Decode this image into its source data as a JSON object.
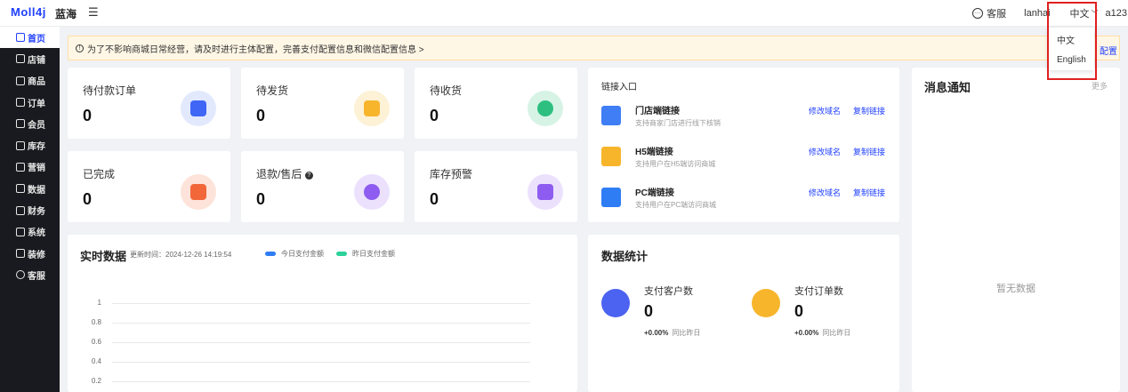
{
  "header": {
    "logo": "Moll4j",
    "shop_name": "蓝海",
    "menu_icon": "menu-icon",
    "service_label": "客服",
    "username": "lanhai",
    "language": "中文",
    "account": "a123"
  },
  "language_menu": {
    "options": [
      "中文",
      "English"
    ]
  },
  "sidebar": {
    "items": [
      {
        "label": "首页",
        "icon": "home-icon"
      },
      {
        "label": "店铺",
        "icon": "shop-icon"
      },
      {
        "label": "商品",
        "icon": "goods-icon"
      },
      {
        "label": "订单",
        "icon": "order-icon"
      },
      {
        "label": "会员",
        "icon": "member-icon"
      },
      {
        "label": "库存",
        "icon": "stock-icon"
      },
      {
        "label": "营销",
        "icon": "gift-icon"
      },
      {
        "label": "数据",
        "icon": "data-icon"
      },
      {
        "label": "财务",
        "icon": "finance-icon"
      },
      {
        "label": "系统",
        "icon": "settings-icon"
      },
      {
        "label": "装修",
        "icon": "decorate-icon"
      },
      {
        "label": "客服",
        "icon": "chat-icon"
      }
    ]
  },
  "alert": {
    "text": "为了不影响商城日常经营，请及时进行主体配置，完善支付配置信息和微信配置信息 >",
    "link": "配置"
  },
  "stats": [
    {
      "label": "待付款订单",
      "value": "0",
      "icon": "wallet-icon",
      "color": "#3f66f5",
      "bg": "#e3e9fd"
    },
    {
      "label": "待发货",
      "value": "0",
      "icon": "truck-icon",
      "color": "#f7b52c",
      "bg": "#fdf1d6"
    },
    {
      "label": "待收货",
      "value": "0",
      "icon": "receiver-icon",
      "color": "#2cbf80",
      "bg": "#d7f3e6"
    },
    {
      "label": "已完成",
      "value": "0",
      "icon": "bag-icon",
      "color": "#f2673a",
      "bg": "#fde3da"
    },
    {
      "label": "退款/售后",
      "value": "0",
      "icon": "money-bag-icon",
      "color": "#8e5cf0",
      "bg": "#ebe1fd"
    },
    {
      "label": "库存预警",
      "value": "0",
      "icon": "box-icon",
      "color": "#8e5cf0",
      "bg": "#ebe1fd"
    }
  ],
  "links": {
    "title": "链接入口",
    "edit_label": "修改域名",
    "copy_label": "复制链接",
    "items": [
      {
        "name": "门店端链接",
        "desc": "支持商家门店进行线下核销",
        "icon": "store-icon",
        "color": "#3f7ef5"
      },
      {
        "name": "H5端链接",
        "desc": "支持用户在H5端访问商城",
        "icon": "h5-icon",
        "color": "#f7b52c"
      },
      {
        "name": "PC端链接",
        "desc": "支持用户在PC端访问商城",
        "icon": "monitor-icon",
        "color": "#2f7df5"
      }
    ]
  },
  "notices": {
    "title": "消息通知",
    "more": "更多",
    "empty": "暂无数据"
  },
  "realtime": {
    "title": "实时数据",
    "updated": "更新时间：2024-12-26  14:19:54",
    "legend": [
      {
        "name": "今日支付金额",
        "color": "#2f7df5"
      },
      {
        "name": "昨日支付金额",
        "color": "#2cd19a"
      }
    ],
    "y_ticks": [
      "1",
      "0.8",
      "0.6",
      "0.4",
      "0.2"
    ]
  },
  "data_stats": {
    "title": "数据统计",
    "items": [
      {
        "label": "支付客户数",
        "value": "0",
        "pct": "+0.00%",
        "cmp": "同比昨日",
        "icon": "user-icon",
        "color": "#4b63f0"
      },
      {
        "label": "支付订单数",
        "value": "0",
        "pct": "+0.00%",
        "cmp": "同比昨日",
        "icon": "clipboard-icon",
        "color": "#f7b52c"
      }
    ]
  }
}
